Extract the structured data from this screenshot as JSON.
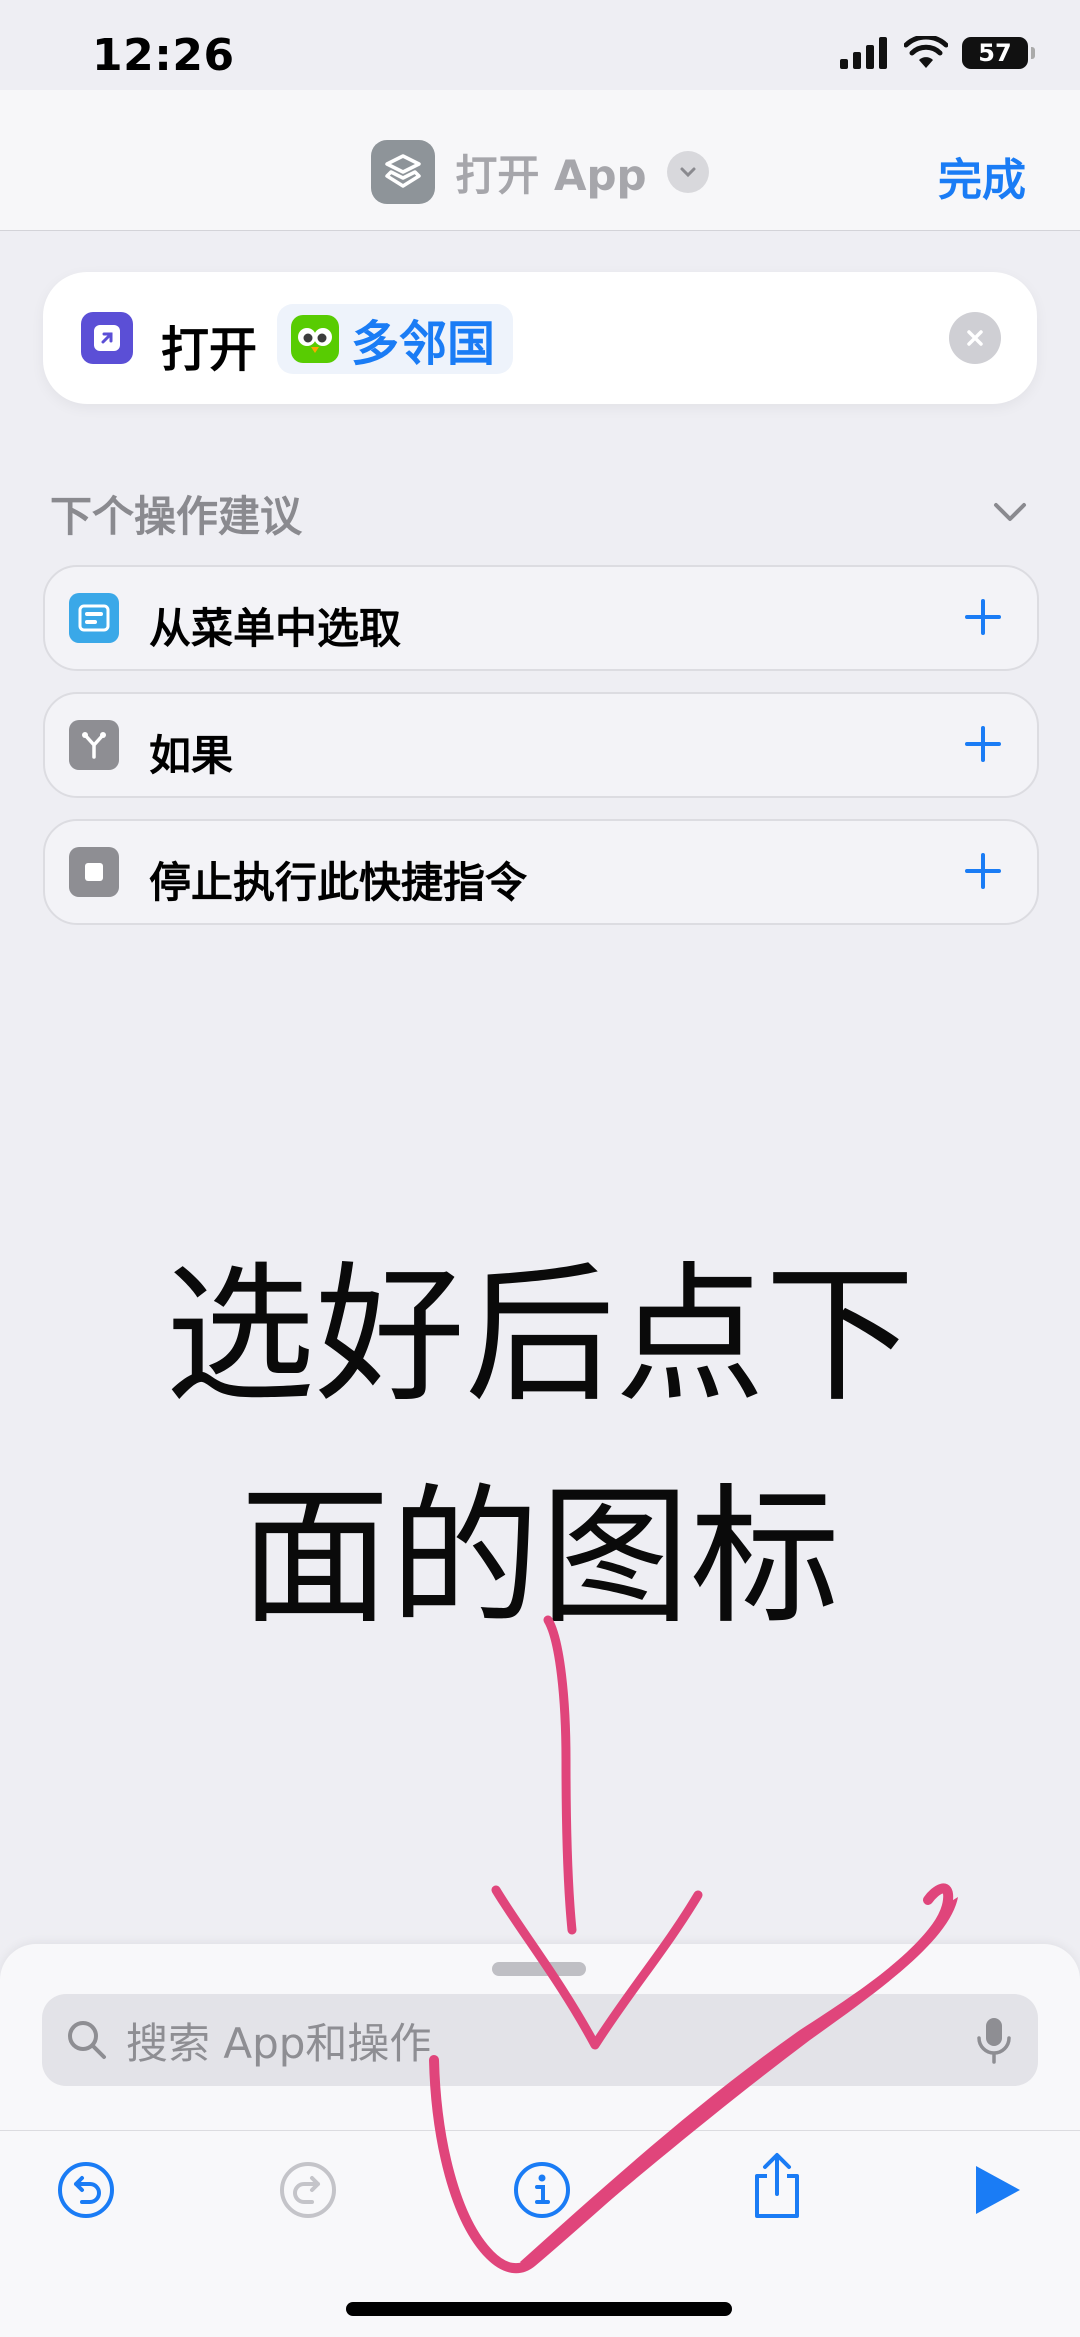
{
  "status_bar": {
    "time": "12:26",
    "battery": "57"
  },
  "nav": {
    "title": "打开 App",
    "done_label": "完成"
  },
  "action": {
    "verb": "打开",
    "app_name": "多邻国"
  },
  "suggestions": {
    "heading": "下个操作建议",
    "items": [
      {
        "label": "从菜单中选取",
        "icon": "menu-list-icon",
        "color": "#3aa8e8"
      },
      {
        "label": "如果",
        "icon": "branch-icon",
        "color": "#8e8e93"
      },
      {
        "label": "停止执行此快捷指令",
        "icon": "stop-icon",
        "color": "#8e8e93"
      }
    ]
  },
  "caption": {
    "line1": "选好后点下",
    "line2": "面的图标"
  },
  "search": {
    "placeholder": "搜索 App和操作"
  },
  "colors": {
    "accent": "#1a7cf5",
    "ink": "#e0457b",
    "background": "#eeeef3"
  }
}
